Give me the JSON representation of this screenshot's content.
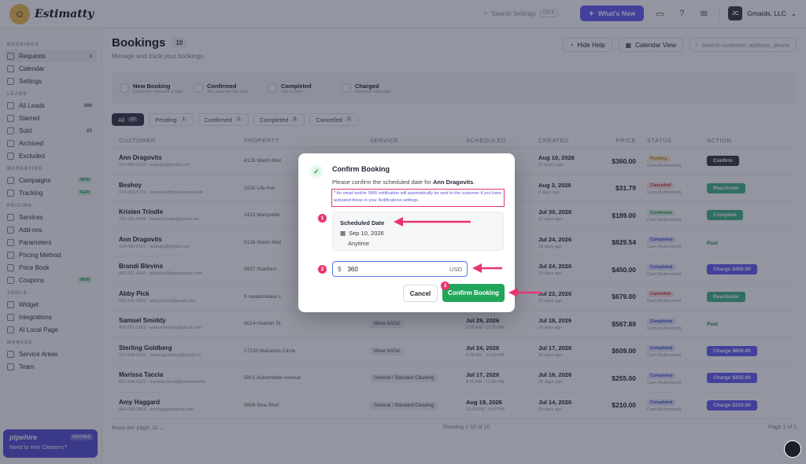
{
  "app": {
    "logo_text": "Estimatty"
  },
  "topbar": {
    "search_placeholder": "Search Settings",
    "search_shortcut": "Ctrl K",
    "new_button": "What's New",
    "account_initials": "JC",
    "account_name": "Gmaids, LLC"
  },
  "sidebar": {
    "sections": [
      {
        "title": "BOOKINGS",
        "items": [
          {
            "label": "Requests",
            "badge": "1",
            "active": true
          },
          {
            "label": "Calendar"
          },
          {
            "label": "Settings"
          }
        ]
      },
      {
        "title": "LEADS",
        "items": [
          {
            "label": "All Leads",
            "badge": "306"
          },
          {
            "label": "Starred"
          },
          {
            "label": "Sold",
            "badge": "25"
          },
          {
            "label": "Archived"
          },
          {
            "label": "Excluded"
          }
        ]
      },
      {
        "title": "MARKETING",
        "items": [
          {
            "label": "Campaigns",
            "tag": "NEW"
          },
          {
            "label": "Tracking",
            "tag": "NEW"
          }
        ]
      },
      {
        "title": "PRICING",
        "items": [
          {
            "label": "Services"
          },
          {
            "label": "Add-ons"
          },
          {
            "label": "Parameters"
          },
          {
            "label": "Pricing Method"
          },
          {
            "label": "Price Book"
          },
          {
            "label": "Coupons",
            "tag": "NEW"
          }
        ]
      },
      {
        "title": "TOOLS",
        "items": [
          {
            "label": "Widget"
          },
          {
            "label": "Integrations"
          },
          {
            "label": "AI Local Page"
          }
        ]
      },
      {
        "title": "MANAGE",
        "items": [
          {
            "label": "Service Areas"
          },
          {
            "label": "Team"
          }
        ]
      }
    ],
    "promo": {
      "brand": "pipehire",
      "badge": "PARTNER",
      "text": "Need to Hire Cleaners?"
    }
  },
  "page": {
    "title": "Bookings",
    "count": "10",
    "subtitle": "Manage and track your bookings.",
    "hide_help": "Hide Help",
    "calendar_view": "Calendar View",
    "search_placeholder": "Search customer, address, phone"
  },
  "steps": [
    {
      "title": "New Booking",
      "sub": "Customer requests a date"
    },
    {
      "title": "Confirmed",
      "sub": "You approve the date"
    },
    {
      "title": "Completed",
      "sub": "Job is done"
    },
    {
      "title": "Charged",
      "sub": "Payment collected"
    }
  ],
  "filters": [
    {
      "label": "All",
      "count": "10"
    },
    {
      "label": "Pending",
      "count": "1"
    },
    {
      "label": "Confirmed",
      "count": "2"
    },
    {
      "label": "Completed",
      "count": "5"
    },
    {
      "label": "Cancelled",
      "count": "0"
    }
  ],
  "table": {
    "headers": [
      "CUSTOMER",
      "PROPERTY",
      "SERVICE",
      "SCHEDULED",
      "CREATED",
      "PRICE",
      "STATUS",
      "ACTION"
    ],
    "rows": [
      {
        "name": "Ann Dragovits",
        "contact": "214-460-6101  ·  asdrago@gmail.com",
        "property": "6126 Warm Mist",
        "service": "",
        "sched": "",
        "created": "Aug 10, 2026",
        "created_sub": "11 hours ago",
        "price": "$360.00",
        "status": "Pending",
        "status_class": "pending",
        "action": "Confirm",
        "action_class": "dark"
      },
      {
        "name": "Beshoy",
        "contact": "214-253-0729  ·  personal@thekeyessentials",
        "property": "1526 Life Ave",
        "service": "",
        "sched": "",
        "created": "Aug 3, 2026",
        "created_sub": "8 days ago",
        "price": "$31.79",
        "status": "Cancelled",
        "status_class": "cancelled",
        "action": "Reactivate",
        "action_class": "green"
      },
      {
        "name": "Kristen Trindle",
        "contact": "732-281-9468  ·  kristen.trindle@proton.me",
        "property": "3313 Marquette",
        "service": "",
        "sched": "",
        "created": "Jul 30, 2026",
        "created_sub": "12 days ago",
        "price": "$189.00",
        "status": "Confirmed",
        "status_class": "confirmed",
        "action": "Complete",
        "action_class": "green"
      },
      {
        "name": "Ann Dragovits",
        "contact": "214-460-6101  ·  asdrago@gmail.com",
        "property": "6126 Warm Mist",
        "service": "",
        "sched": "",
        "created": "Jul 24, 2026",
        "created_sub": "18 days ago",
        "price": "$829.54",
        "status": "Completed",
        "status_class": "completed",
        "action": "Paid",
        "action_class": "paid"
      },
      {
        "name": "Brandi Blevins",
        "contact": "405-301-6666  ·  bblevins@bigsterteam.com",
        "property": "5637 Stanford",
        "service": "",
        "sched": "",
        "created": "Jul 24, 2026",
        "created_sub": "18 days ago",
        "price": "$450.00",
        "status": "Completed",
        "status_class": "completed",
        "action": "Charge $450.00",
        "action_class": "purple"
      },
      {
        "name": "Abby Pick",
        "contact": "606-541-9261  ·  abbypick10@gmail.com",
        "property": "9 meadowlake c",
        "service": "",
        "sched": "",
        "created": "Jul 22, 2026",
        "created_sub": "20 days ago",
        "price": "$679.00",
        "status": "Cancelled",
        "status_class": "cancelled",
        "action": "Reactivate",
        "action_class": "green"
      },
      {
        "name": "Samuel Smiddy",
        "contact": "405-351-1602  ·  samuelsmiddy@gmail.com",
        "property": "6024 Hudson St",
        "service": "Move In/Out",
        "sched": "Jul 29, 2026",
        "sched_sub": "9:00 AM - 12:00 PM",
        "created": "Jul 18, 2026",
        "created_sub": "24 days ago",
        "price": "$567.89",
        "status": "Completed",
        "status_class": "completed",
        "action": "Paid",
        "action_class": "paid"
      },
      {
        "name": "Sterling Goldberg",
        "contact": "972-949-9193  ·  sterlinggoldberg@gmail.co",
        "property": "17230 Marianne Circle",
        "service": "Move In/Out",
        "sched": "Jul 24, 2026",
        "sched_sub": "8:00 AM - 12:00 PM",
        "created": "Jul 17, 2026",
        "created_sub": "25 days ago",
        "price": "$609.00",
        "status": "Completed",
        "status_class": "completed",
        "action": "Charge $609.00",
        "action_class": "purple"
      },
      {
        "name": "Marissa Taccia",
        "contact": "817-344-6622  ·  marissa.taccia@eventsworth",
        "property": "5901 Auburndale Avenue",
        "service": "General / Standard Cleaning",
        "sched": "Jul 17, 2026",
        "sched_sub": "8:00 AM - 12:00 PM",
        "created": "Jul 16, 2026",
        "created_sub": "26 days ago",
        "price": "$255.00",
        "status": "Completed",
        "status_class": "completed",
        "action": "Charge $255.00",
        "action_class": "purple"
      },
      {
        "name": "Amy Haggard",
        "contact": "949-698-3864  ·  amyhaggard@me.com",
        "property": "5609 Smu Blvd",
        "service": "General / Standard Cleaning",
        "sched": "Aug 19, 2026",
        "sched_sub": "12:00 PM - 4:00 PM",
        "created": "Jul 14, 2026",
        "created_sub": "28 days ago",
        "price": "$210.00",
        "status": "Completed",
        "status_class": "completed",
        "action": "Charge $210.00",
        "action_class": "purple"
      }
    ],
    "status_sub": "Card (Authorized)",
    "footer": {
      "rows_label": "Rows per page:",
      "rows_value": "10",
      "showing": "Showing 1-10 of 10",
      "page": "Page 1 of 1"
    }
  },
  "modal": {
    "title": "Confirm Booking",
    "subtitle_prefix": "Please confirm the scheduled date for",
    "customer": "Ann Dragovits",
    "note": "* An email and/or SMS notification will automatically be sent to the customer if you have activated these in your Notifications settings.",
    "card_title": "Scheduled Date",
    "date": "Sep 10, 2026",
    "time": "Anytime",
    "currency_symbol": "$",
    "price_value": "360",
    "currency": "USD",
    "cancel_label": "Cancel",
    "confirm_label": "Confirm Booking",
    "markers": [
      "1",
      "2",
      "3"
    ],
    "annotation_color": "#e83570"
  }
}
